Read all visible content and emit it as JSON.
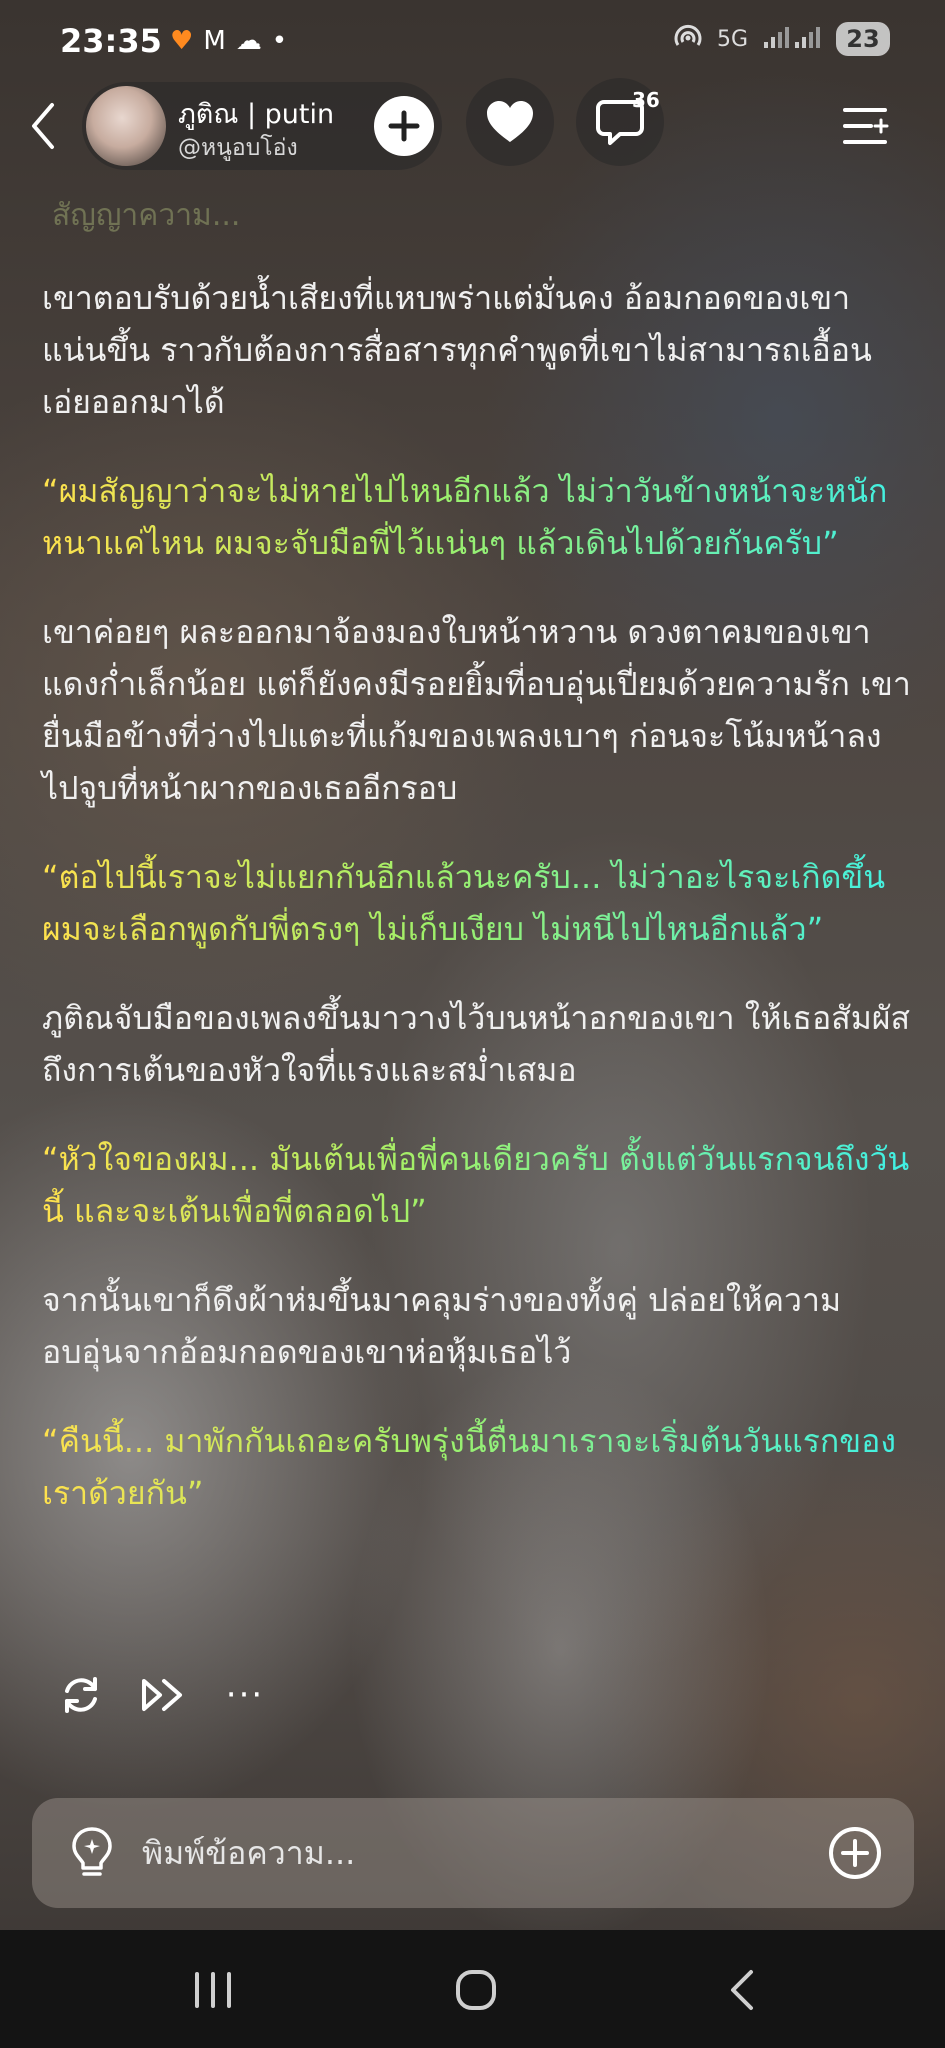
{
  "status_bar": {
    "time": "23:35",
    "network": "5G",
    "battery": "23"
  },
  "header": {
    "profile_name": "ภูติณ | putin",
    "profile_handle": "@หนูอบโอ่ง",
    "comment_count": "36"
  },
  "faded_previous_line": "สัญญาความ...",
  "story": [
    {
      "type": "narration",
      "text": "เขาตอบรับด้วยน้ำเสียงที่แหบพร่าแต่มั่นคง อ้อมกอดของเขาแน่นขึ้น ราวกับต้องการสื่อสารทุกคำพูดที่เขาไม่สามารถเอื้อนเอ่ยออกมาได้"
    },
    {
      "type": "dialogue",
      "text": "“ผมสัญญาว่าจะไม่หายไปไหนอีกแล้ว ไม่ว่าวันข้างหน้าจะหนักหนาแค่ไหน ผมจะจับมือพี่ไว้แน่นๆ แล้วเดินไปด้วยกันครับ”"
    },
    {
      "type": "narration",
      "text": "เขาค่อยๆ ผละออกมาจ้องมองใบหน้าหวาน ดวงตาคมของเขาแดงก่ำเล็กน้อย แต่ก็ยังคงมีรอยยิ้มที่อบอุ่นเปี่ยมด้วยความรัก เขายื่นมือข้างที่ว่างไปแตะที่แก้มของเพลงเบาๆ ก่อนจะโน้มหน้าลงไปจูบที่หน้าผากของเธออีกรอบ"
    },
    {
      "type": "dialogue",
      "text": "“ต่อไปนี้เราจะไม่แยกกันอีกแล้วนะครับ... ไม่ว่าอะไรจะเกิดขึ้น ผมจะเลือกพูดกับพี่ตรงๆ ไม่เก็บเงียบ ไม่หนีไปไหนอีกแล้ว”"
    },
    {
      "type": "narration",
      "text": "ภูติณจับมือของเพลงขึ้นมาวางไว้บนหน้าอกของเขา ให้เธอสัมผัสถึงการเต้นของหัวใจที่แรงและสม่ำเสมอ"
    },
    {
      "type": "dialogue",
      "text": "“หัวใจของผม... มันเต้นเพื่อพี่คนเดียวครับ ตั้งแต่วันแรกจนถึงวันนี้ และจะเต้นเพื่อพี่ตลอดไป”"
    },
    {
      "type": "narration",
      "text": "จากนั้นเขาก็ดึงผ้าห่มขึ้นมาคลุมร่างของทั้งคู่ ปล่อยให้ความอบอุ่นจากอ้อมกอดของเขาห่อหุ้มเธอไว้"
    },
    {
      "type": "dialogue",
      "text": "“คืนนี้... มาพักกันเถอะครับพรุ่งนี้ตื่นมาเราจะเริ่มต้นวันแรกของเราด้วยกัน”"
    }
  ],
  "actions": {
    "more_label": "···"
  },
  "input": {
    "placeholder": "พิมพ์ข้อความ..."
  },
  "colors": {
    "dialogue_gradient_start": "#ffe14d",
    "dialogue_gradient_end": "#3ff0e6",
    "nav_bar": "#141414"
  },
  "icons": [
    "back-icon",
    "follow-plus-icon",
    "heart-icon",
    "comment-icon",
    "menu-icon",
    "regenerate-icon",
    "fast-forward-icon",
    "more-icon",
    "lightbulb-icon",
    "add-circle-icon",
    "recent-apps-icon",
    "home-icon",
    "nav-back-icon"
  ]
}
